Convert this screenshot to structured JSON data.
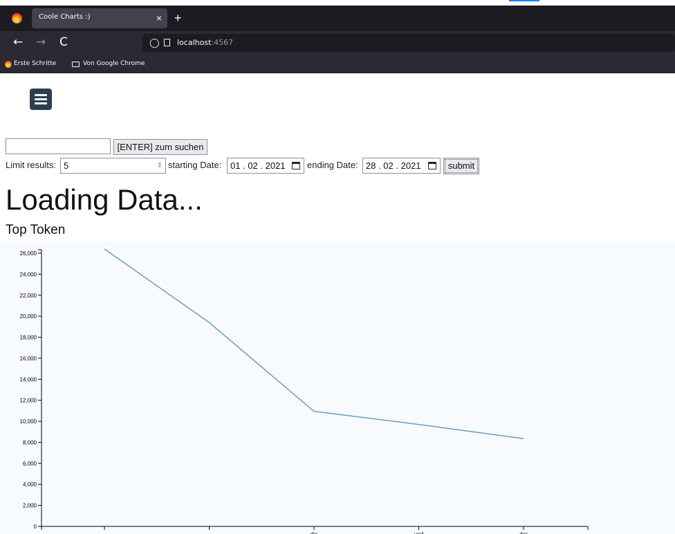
{
  "browser": {
    "tab_title": "Coole Charts :)",
    "tab_close": "×",
    "new_tab": "+",
    "url_host": "localhost",
    "url_port": ":4567",
    "nav": {
      "back": "←",
      "forward": "→",
      "reload": "C"
    },
    "bookmarks": [
      "Erste Schritte",
      "Von Google Chrome"
    ]
  },
  "page": {
    "search": {
      "value": "",
      "button_label": "[ENTER] zum suchen"
    },
    "limit": {
      "label": "Limit results:",
      "value": "5"
    },
    "start_date": {
      "label": "starting Date:",
      "value": "01 . 02 . 2021"
    },
    "end_date": {
      "label": "ending Date:",
      "value": "28 . 02 . 2021"
    },
    "submit_label": "submit",
    "loading_text": "Loading Data...",
    "chart_title": "Top Token"
  },
  "chart_data": {
    "type": "line",
    "title": "Top Token",
    "xlabel": "",
    "ylabel": "",
    "categories": [
      "",
      "",
      "die",
      "und",
      "der"
    ],
    "values": [
      26400,
      19400,
      10950,
      9700,
      8350
    ],
    "ylim": [
      0,
      26000
    ],
    "yticks": [
      0,
      2000,
      4000,
      6000,
      8000,
      10000,
      12000,
      14000,
      16000,
      18000,
      20000,
      22000,
      24000,
      26000
    ],
    "line_color": "#6a9ec3"
  }
}
